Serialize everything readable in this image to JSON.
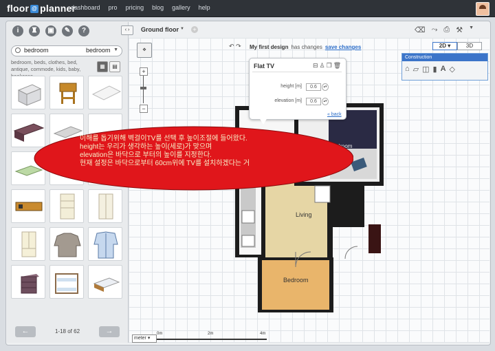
{
  "app": {
    "logo_left": "floor",
    "logo_mid": "@",
    "logo_right": "planner",
    "nav": [
      "dashboard",
      "pro",
      "pricing",
      "blog",
      "gallery",
      "help"
    ]
  },
  "library": {
    "search_query": "bedroom",
    "search_category": "bedroom",
    "tags": "bedroom, beds, clothes, bed, antique, commode, kids, baby, bookcase,",
    "pager_label": "1-18 of 62"
  },
  "floor": {
    "name": "Ground floor"
  },
  "design": {
    "title": "My first design",
    "status": "has changes",
    "save_link": "save changes"
  },
  "view_toggle": [
    "2D",
    "3D"
  ],
  "construction": {
    "title": "Construction"
  },
  "flat_tv_panel": {
    "title": "Flat TV",
    "height_label": "height [m]",
    "height_value": "0.6",
    "elevation_label": "elevation [m]",
    "elevation_value": "0.6",
    "back_link": "« back"
  },
  "room_labels": {
    "bedroom_top": "Bedroom",
    "living": "Living",
    "bedroom_bottom": "Bedroom"
  },
  "scale": {
    "unit": "meter",
    "start": "0m",
    "mid": "2m",
    "end": "4m"
  },
  "callout": {
    "line1": "이해를 돕기위해 벽걸이TV를 선택 후 높이조절에 들어왔다.",
    "line2": "height는 우리가 생각하는 높이(세로)가 맞으며",
    "line3": "elevation은 바닥으로 부터의 높이를 지정한다.",
    "line4": "현재 설정은 바닥으로부터 60cm위에 TV를 설치하겠다는 거"
  },
  "colors": {
    "accent": "#3b74c9",
    "callout_fill": "#e0161b",
    "wall": "#1c1c1c",
    "floor_living": "#e6d6a5",
    "floor_bedroom_bottom": "#e9b56b"
  }
}
